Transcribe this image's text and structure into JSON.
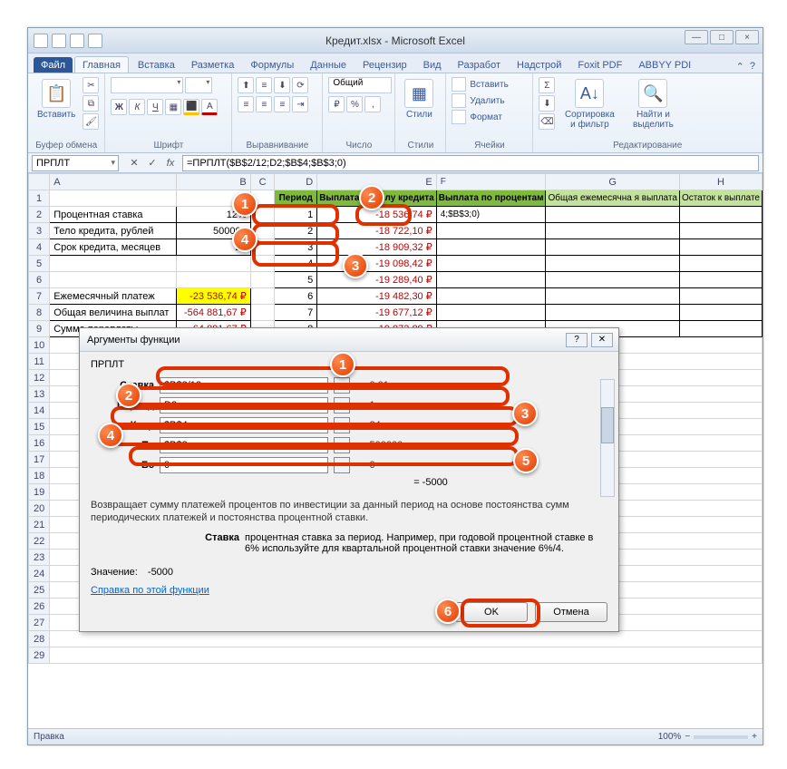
{
  "window": {
    "title": "Кредит.xlsx - Microsoft Excel",
    "min": "—",
    "max": "□",
    "close": "×"
  },
  "tabs": {
    "file": "Файл",
    "home": "Главная",
    "list": [
      "Вставка",
      "Разметка",
      "Формулы",
      "Данные",
      "Рецензир",
      "Вид",
      "Разработ",
      "Надстрой",
      "Foxit PDF",
      "ABBYY PDI"
    ]
  },
  "ribbon": {
    "paste": "Вставить",
    "clipboard": "Буфер обмена",
    "font": "Шрифт",
    "align": "Выравнивание",
    "numberfmt": "Общий",
    "number": "Число",
    "styles_btn": "Стили",
    "styles": "Стили",
    "insert": "Вставить",
    "delete": "Удалить",
    "format": "Формат",
    "cells": "Ячейки",
    "sort": "Сортировка и фильтр",
    "find": "Найти и выделить",
    "editing": "Редактирование",
    "sigma": "Σ"
  },
  "formulaBar": {
    "name": "ПРПЛТ",
    "cancel": "✕",
    "enter": "✓",
    "fx": "fx",
    "formula": "=ПРПЛТ($B$2/12;D2;$B$4;$B$3;0)"
  },
  "columns": [
    "A",
    "B",
    "C",
    "D",
    "E",
    "F",
    "G",
    "H"
  ],
  "headers": {
    "D": "Период",
    "E": "Выплата по телу кредита",
    "F": "Выплата по процентам",
    "G": "Общая ежемесячна я выплата",
    "H": "Остаток к выплате"
  },
  "rowsA": {
    "2": "Процентная ставка",
    "3": "Тело кредита, рублей",
    "4": "Срок кредита, месяцев",
    "7": "Ежемесячный платеж",
    "8": "Общая величина выплат",
    "9": "Сумма переплаты"
  },
  "rowsB": {
    "2": "12%",
    "3": "500000",
    "4": "24",
    "7": "-23 536,74 ₽",
    "8": "-564 881,67 ₽",
    "9": "-64 881,67 ₽"
  },
  "dataRows": [
    {
      "n": "2",
      "d": "1",
      "e": "-18 536,74 ₽",
      "f": "4;$B$3;0)"
    },
    {
      "n": "3",
      "d": "2",
      "e": "-18 722,10 ₽",
      "f": ""
    },
    {
      "n": "4",
      "d": "3",
      "e": "-18 909,32 ₽",
      "f": ""
    },
    {
      "n": "5",
      "d": "4",
      "e": "-19 098,42 ₽",
      "f": ""
    },
    {
      "n": "6",
      "d": "5",
      "e": "-19 289,40 ₽",
      "f": ""
    },
    {
      "n": "7",
      "d": "6",
      "e": "-19 482,30 ₽",
      "f": ""
    },
    {
      "n": "8",
      "d": "7",
      "e": "-19 677,12 ₽",
      "f": ""
    },
    {
      "n": "9",
      "d": "8",
      "e": "-19 873,89 ₽",
      "f": ""
    }
  ],
  "dialog": {
    "title": "Аргументы функции",
    "help": "?",
    "close": "✕",
    "func": "ПРПЛТ",
    "args": [
      {
        "label": "Ставка",
        "input": "$B$2/12",
        "val": "= 0,01"
      },
      {
        "label": "Период",
        "input": "D2",
        "val": "= 1"
      },
      {
        "label": "Кпер",
        "input": "$B$4",
        "val": "= 24"
      },
      {
        "label": "Пс",
        "input": "$B$3",
        "val": "= 500000"
      },
      {
        "label": "Бс",
        "input": "0",
        "val": "= 0"
      }
    ],
    "resultTop": "= -5000",
    "desc": "Возвращает сумму платежей процентов по инвестиции за данный период на основе постоянства сумм периодических платежей и постоянства процентной ставки.",
    "paramLabel": "Ставка",
    "paramDesc": "процентная ставка за период. Например, при годовой процентной ставке в 6% используйте для квартальной процентной ставки значение 6%/4.",
    "resultLabel": "Значение:",
    "resultVal": "-5000",
    "helpLink": "Справка по этой функции",
    "ok": "OK",
    "cancel": "Отмена"
  },
  "status": {
    "mode": "Правка",
    "zoom": "100%"
  },
  "callouts": {
    "top": {
      "1": "1",
      "2": "2",
      "3": "3",
      "4": "4"
    },
    "dlg": {
      "1": "1",
      "2": "2",
      "3": "3",
      "4": "4",
      "5": "5",
      "6": "6"
    }
  }
}
